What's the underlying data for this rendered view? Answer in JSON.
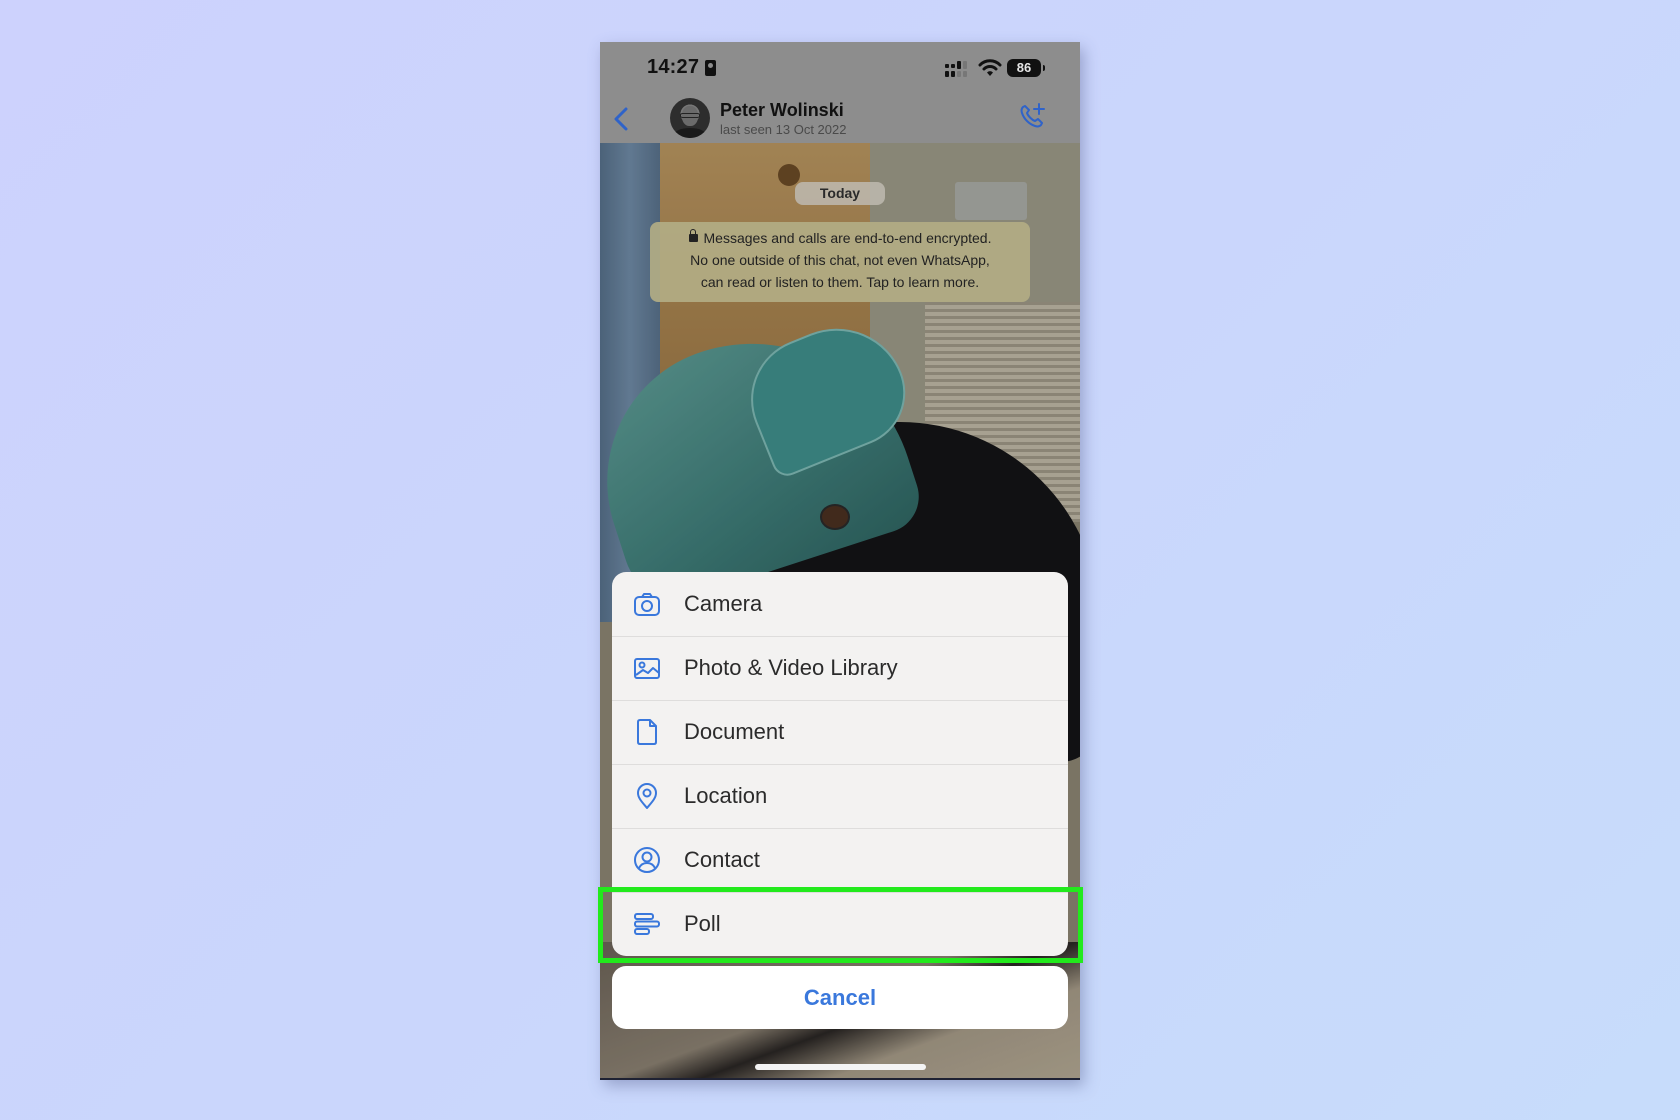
{
  "status_bar": {
    "time": "14:27",
    "battery": "86",
    "icons": [
      "id-badge-icon",
      "signal-icon",
      "wifi-icon",
      "battery-icon"
    ]
  },
  "header": {
    "back_icon": "chevron-left-icon",
    "contact_name": "Peter Wolinski",
    "last_seen": "last seen 13 Oct 2022",
    "call_icon": "phone-plus-icon"
  },
  "chat": {
    "date_pill": "Today",
    "encryption_notice": {
      "line1": "Messages and calls are end-to-end encrypted.",
      "line2": "No one outside of this chat, not even WhatsApp,",
      "line3": "can read or listen to them. Tap to learn more."
    }
  },
  "attach_sheet": {
    "items": [
      {
        "label": "Camera",
        "icon": "camera-icon"
      },
      {
        "label": "Photo & Video Library",
        "icon": "photo-icon"
      },
      {
        "label": "Document",
        "icon": "document-icon"
      },
      {
        "label": "Location",
        "icon": "location-pin-icon"
      },
      {
        "label": "Contact",
        "icon": "contact-icon"
      },
      {
        "label": "Poll",
        "icon": "poll-icon"
      }
    ],
    "cancel_label": "Cancel",
    "highlighted_item": "Poll"
  },
  "colors": {
    "accent_blue": "#3a78dc",
    "highlight_green": "#22ea1c",
    "page_background": "#cbd5fc"
  }
}
